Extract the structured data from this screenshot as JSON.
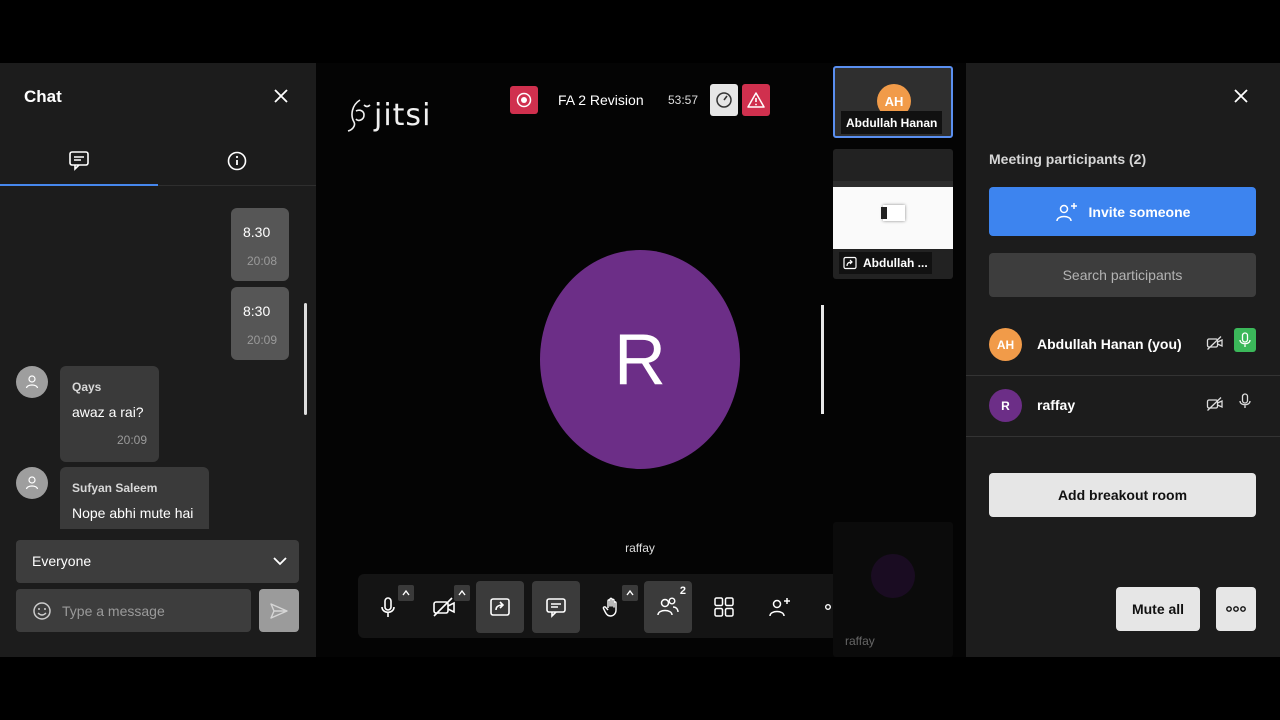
{
  "chat": {
    "title": "Chat",
    "messages": [
      {
        "sender": "",
        "text": "8.30",
        "time": "20:08",
        "mine": true
      },
      {
        "sender": "",
        "text": "8:30",
        "time": "20:09",
        "mine": true
      },
      {
        "sender": "Qays",
        "text": "awaz a rai?",
        "time": "20:09",
        "mine": false
      },
      {
        "sender": "Sufyan Saleem",
        "text": "Nope abhi mute hai",
        "time": "",
        "mine": false
      }
    ],
    "recipient": "Everyone",
    "input_placeholder": "Type a message"
  },
  "stage": {
    "logo": "jitsi",
    "meeting_title": "FA 2 Revision",
    "timer": "53:57",
    "speaker_initial": "R",
    "speaker_name": "raffay",
    "participant_count": "2"
  },
  "filmstrip": {
    "local_initials": "AH",
    "local_name": "Abdullah Hanan",
    "screenshare_name": "Abdullah ...",
    "remote_name": "raffay"
  },
  "participants": {
    "header": "Meeting participants (2)",
    "invite_label": "Invite someone",
    "search_placeholder": "Search participants",
    "list": [
      {
        "initials": "AH",
        "name": "Abdullah Hanan (you)",
        "color": "#f19b49"
      },
      {
        "initials": "R",
        "name": "raffay",
        "color": "#6c2e87"
      }
    ],
    "breakout_label": "Add breakout room",
    "mute_all_label": "Mute all"
  },
  "colors": {
    "accent": "#3d84ef",
    "danger": "#d0304e",
    "mic_active": "#3bb85a"
  }
}
